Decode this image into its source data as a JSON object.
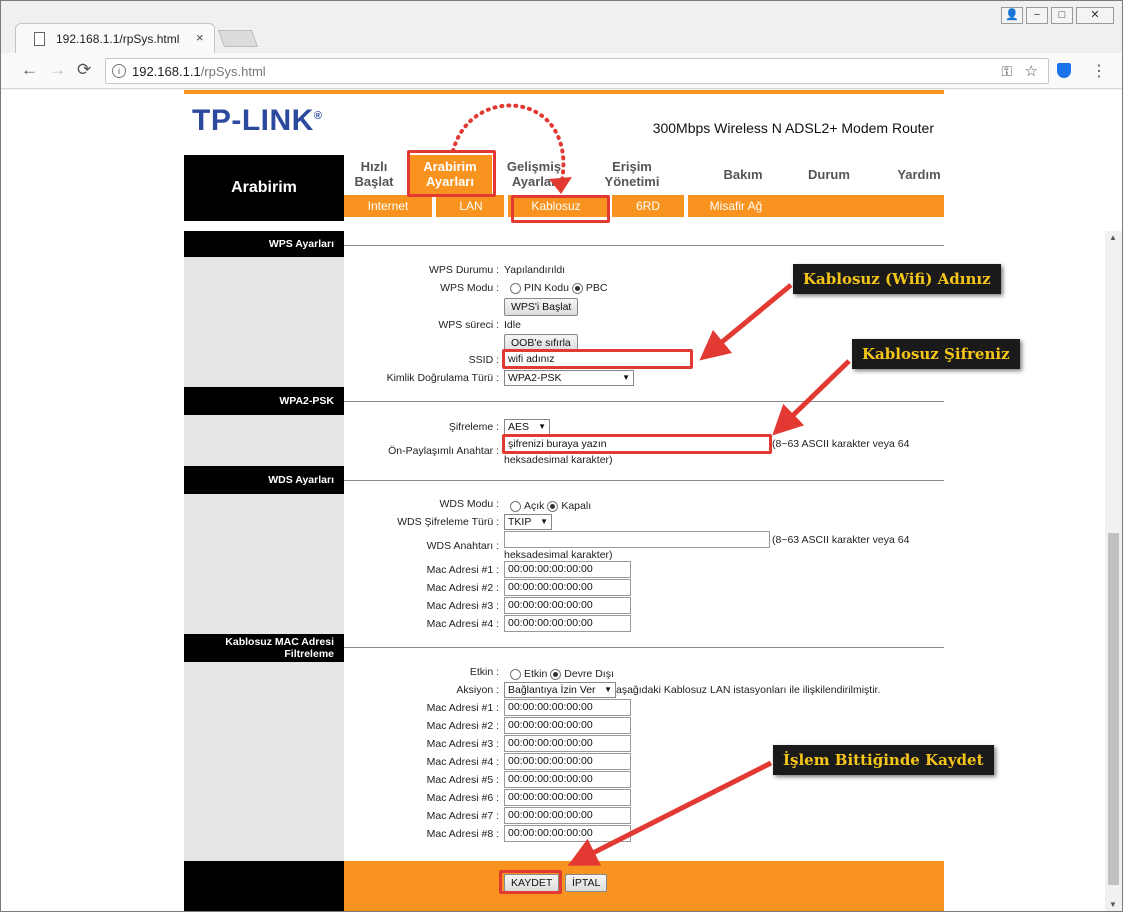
{
  "browser": {
    "tab_title": "192.168.1.1/rpSys.html",
    "tab_close": "×",
    "url_host": "192.168.1.1",
    "url_path": "/rpSys.html",
    "info_glyph": "i",
    "win_min": "−",
    "win_max": "□",
    "win_close": "✕",
    "win_user": "👤",
    "back_glyph": "←",
    "fwd_glyph": "→",
    "reload_glyph": "⟳",
    "key_glyph": "⚿",
    "star_glyph": "☆",
    "menu_glyph": "⋮"
  },
  "router": {
    "logo": "TP-LINK",
    "logo_reg": "®",
    "model": "300Mbps Wireless N ADSL2+ Modem Router",
    "section_title": "Arabirim",
    "nav": [
      {
        "line1": "Hızlı",
        "line2": "Başlat"
      },
      {
        "line1": "Arabirim",
        "line2": "Ayarları"
      },
      {
        "line1": "Gelişmiş",
        "line2": "Ayarlar"
      },
      {
        "line1": "Erişim",
        "line2": "Yönetimi"
      },
      {
        "line1": "Bakım",
        "line2": ""
      },
      {
        "line1": "Durum",
        "line2": ""
      },
      {
        "line1": "Yardım",
        "line2": ""
      }
    ],
    "subnav": [
      "Internet",
      "LAN",
      "Kablosuz",
      "6RD",
      "Misafir Ağ"
    ],
    "wps": {
      "header": "WPS Ayarları",
      "status_label": "WPS Durumu :",
      "status_value": "Yapılandırıldı",
      "mode_label": "WPS Modu :",
      "mode_pin": "PIN Kodu",
      "mode_pbc": "PBC",
      "start_button": "WPS'i Başlat",
      "process_label": "WPS süreci :",
      "process_value": "Idle",
      "oob_button": "OOB'e sıfırla",
      "ssid_label": "SSID :",
      "ssid_value": "wifi adınız",
      "auth_label": "Kimlik Doğrulama Türü :",
      "auth_value": "WPA2-PSK"
    },
    "wpa": {
      "header": "WPA2-PSK",
      "enc_label": "Şifreleme :",
      "enc_value": "AES",
      "psk_label": "Ön-Paylaşımlı Anahtar :",
      "psk_value": "şifrenizi buraya yazın",
      "psk_hint1": "(8~63 ASCII karakter veya 64",
      "psk_hint2": "heksadesimal karakter)"
    },
    "wds": {
      "header": "WDS Ayarları",
      "mode_label": "WDS Modu :",
      "mode_on": "Açık",
      "mode_off": "Kapalı",
      "enc_label": "WDS Şifreleme Türü :",
      "enc_value": "TKIP",
      "key_label": "WDS Anahtarı :",
      "key_hint1": "(8~63 ASCII karakter veya 64",
      "key_hint2": "heksadesimal karakter)",
      "macs": [
        {
          "label": "Mac Adresi #1 :",
          "value": "00:00:00:00:00:00"
        },
        {
          "label": "Mac Adresi #2 :",
          "value": "00:00:00:00:00:00"
        },
        {
          "label": "Mac Adresi #3 :",
          "value": "00:00:00:00:00:00"
        },
        {
          "label": "Mac Adresi #4 :",
          "value": "00:00:00:00:00:00"
        }
      ]
    },
    "macfilter": {
      "header1": "Kablosuz MAC Adresi",
      "header2": "Filtreleme",
      "enable_label": "Etkin :",
      "enable_on": "Etkin",
      "enable_off": "Devre Dışı",
      "action_label": "Aksiyon :",
      "action_value": "Bağlantıya İzin Ver",
      "action_suffix": "aşağıdaki Kablosuz LAN istasyonları ile ilişkilendirilmiştir.",
      "macs": [
        {
          "label": "Mac Adresi #1 :",
          "value": "00:00:00:00:00:00"
        },
        {
          "label": "Mac Adresi #2 :",
          "value": "00:00:00:00:00:00"
        },
        {
          "label": "Mac Adresi #3 :",
          "value": "00:00:00:00:00:00"
        },
        {
          "label": "Mac Adresi #4 :",
          "value": "00:00:00:00:00:00"
        },
        {
          "label": "Mac Adresi #5 :",
          "value": "00:00:00:00:00:00"
        },
        {
          "label": "Mac Adresi #6 :",
          "value": "00:00:00:00:00:00"
        },
        {
          "label": "Mac Adresi #7 :",
          "value": "00:00:00:00:00:00"
        },
        {
          "label": "Mac Adresi #8 :",
          "value": "00:00:00:00:00:00"
        }
      ]
    },
    "save_button": "KAYDET",
    "cancel_button": "İPTAL"
  },
  "annotations": {
    "ssid_callout": "Kablosuz (Wifi) Adınız",
    "password_callout": "Kablosuz Şifreniz",
    "save_callout": "İşlem Bittiğinde Kaydet",
    "accent_color": "#e23a32",
    "callout_text_color": "#f5c518"
  }
}
